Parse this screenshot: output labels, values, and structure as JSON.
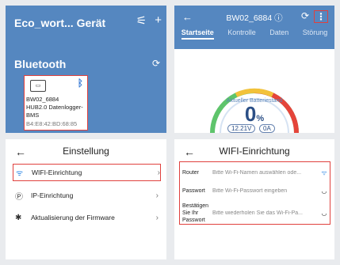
{
  "panel1": {
    "title": "Eco_wort... Gerät",
    "section": "Bluetooth",
    "card": {
      "device_name": "BW02_6884",
      "device_type": "HUB2.0 Datenlogger-",
      "line3": "BMS",
      "mac": "B4:E8:42:BD:68:85"
    }
  },
  "panel2": {
    "device_name": "BW02_6884",
    "tabs": [
      "Startseite",
      "Kontrolle",
      "Daten",
      "Störung"
    ],
    "gauge_label": "Aktueller Batteriestand",
    "gauge_value": "0",
    "gauge_unit": "%",
    "voltage": "12.21V",
    "current": "0A"
  },
  "panel3": {
    "title": "Einstellung",
    "items": [
      {
        "label": "WIFI-Einrichtung"
      },
      {
        "label": "IP-Einrichtung"
      },
      {
        "label": "Aktualisierung der Firmware"
      }
    ]
  },
  "panel4": {
    "title": "WIFI-Einrichtung",
    "fields": [
      {
        "label": "Router",
        "placeholder": "Bitte Wi-Fi-Namen auswählen ode..."
      },
      {
        "label": "Passwort",
        "placeholder": "Bitte Wi-Fi-Passwort eingeben"
      },
      {
        "label": "Bestätigen Sie Ihr Passwort",
        "placeholder": "Bitte wiederholen Sie das Wi-Fi-Pa..."
      }
    ]
  }
}
